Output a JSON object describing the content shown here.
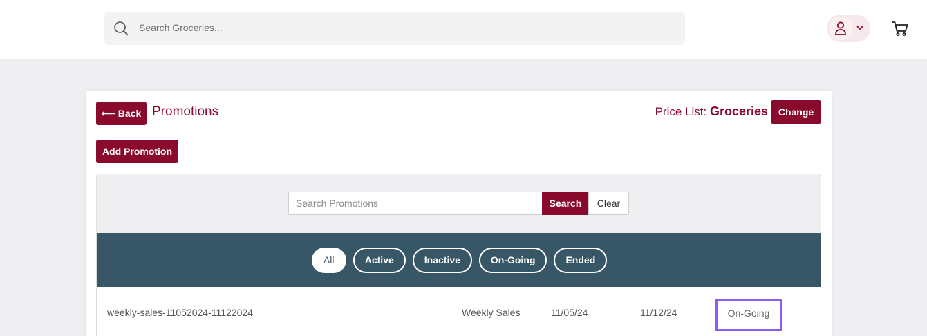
{
  "header": {
    "search_placeholder": "Search Groceries..."
  },
  "page": {
    "back_label": "Back",
    "title": "Promotions",
    "price_list_label": "Price List:",
    "price_list_value": "Groceries",
    "change_label": "Change",
    "add_promotion_label": "Add Promotion"
  },
  "search": {
    "placeholder": "Search Promotions",
    "search_label": "Search",
    "clear_label": "Clear"
  },
  "filters": [
    {
      "label": "All",
      "active": true
    },
    {
      "label": "Active",
      "active": false
    },
    {
      "label": "Inactive",
      "active": false
    },
    {
      "label": "On-Going",
      "active": false
    },
    {
      "label": "Ended",
      "active": false
    }
  ],
  "promotions": [
    {
      "name": "weekly-sales-11052024-11122024",
      "type": "Weekly Sales",
      "start": "11/05/24",
      "end": "11/12/24",
      "status": "On-Going"
    }
  ],
  "colors": {
    "brand": "#8a0a2e",
    "filter_bar": "#385766",
    "highlight": "#8b5cf6"
  }
}
